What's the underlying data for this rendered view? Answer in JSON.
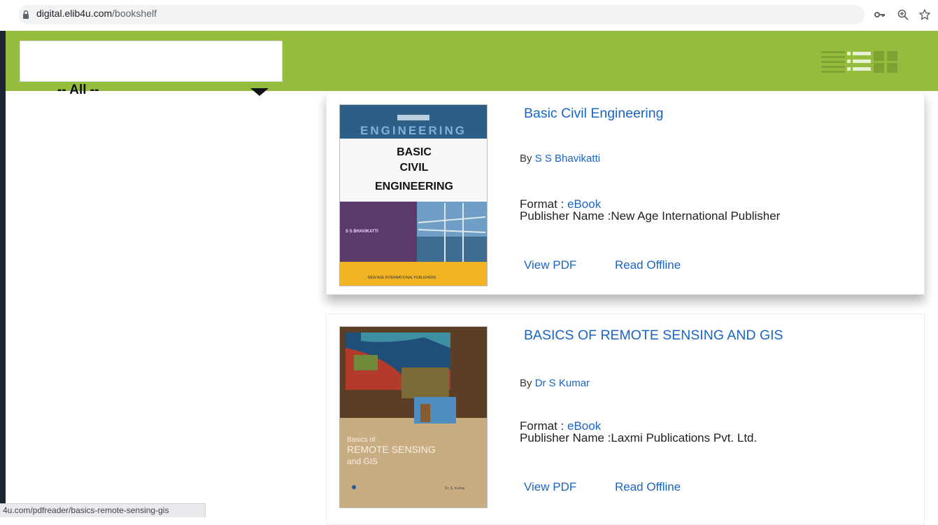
{
  "browser": {
    "url_host": "digital.elib4u.com",
    "url_path": "/bookshelf",
    "status_url": "4u.com/pdfreader/basics-remote-sensing-gis",
    "icons": [
      "lock-icon",
      "key-icon",
      "zoom-icon",
      "star-icon"
    ]
  },
  "header": {
    "search_value": "",
    "view_icons": [
      "compact-list-view-icon",
      "list-view-icon",
      "grid-view-icon"
    ],
    "bg_color": "#95bd3d"
  },
  "filter": {
    "category_selected": "-- All --"
  },
  "books": [
    {
      "title": "Basic Civil Engineering",
      "by_prefix": "By ",
      "author": "S S Bhavikatti",
      "format_label": "Format : ",
      "format_value": "eBook",
      "publisher_label": "Publisher Name :",
      "publisher": "New Age International Publisher",
      "view_pdf": "View PDF",
      "read_offline": "Read Offline",
      "cover": {
        "series": "ENGINEERING",
        "title_lines": [
          "BASIC",
          "CIVIL",
          "ENGINEERING"
        ],
        "author": "S S BHAVIKATTI",
        "publisher": "NEW AGE INTERNATIONAL PUBLISHERS"
      }
    },
    {
      "title": "BASICS OF REMOTE SENSING AND GIS",
      "by_prefix": "By ",
      "author": "Dr S Kumar",
      "format_label": "Format : ",
      "format_value": "eBook",
      "publisher_label": "Publisher Name :",
      "publisher": "Laxmi Publications Pvt. Ltd.",
      "view_pdf": "View PDF",
      "read_offline": "Read Offline",
      "cover": {
        "title_lines": [
          "Basics of",
          "REMOTE SENSING",
          "and GIS"
        ],
        "author": "Dr. S. Kumar"
      }
    }
  ],
  "colors": {
    "link": "#1a64c4",
    "header_green": "#95bd3d"
  }
}
